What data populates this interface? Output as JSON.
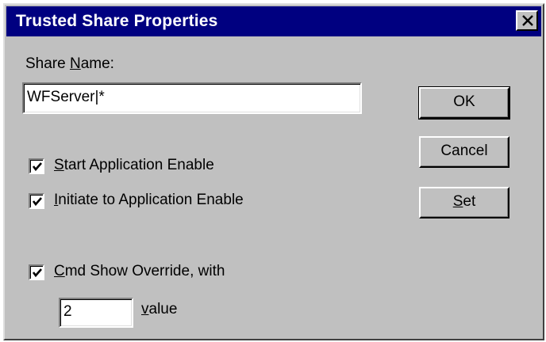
{
  "window": {
    "title": "Trusted Share Properties",
    "close_icon": "close-icon"
  },
  "share_name": {
    "label_prefix": "Share ",
    "label_accel": "N",
    "label_suffix": "ame:",
    "value": "WFServer|*"
  },
  "options": [
    {
      "accel": "S",
      "rest": "tart Application Enable",
      "checked": true
    },
    {
      "accel": "I",
      "rest": "nitiate to Application Enable",
      "checked": true
    },
    {
      "accel": "C",
      "rest": "md Show Override, with",
      "checked": true
    }
  ],
  "cmd_show": {
    "value": "2",
    "label_accel": "v",
    "label_rest": "alue"
  },
  "buttons": {
    "ok": "OK",
    "cancel": "Cancel",
    "set_accel": "S",
    "set_rest": "et"
  },
  "colors": {
    "titlebar": "#000080",
    "face": "#c0c0c0"
  }
}
